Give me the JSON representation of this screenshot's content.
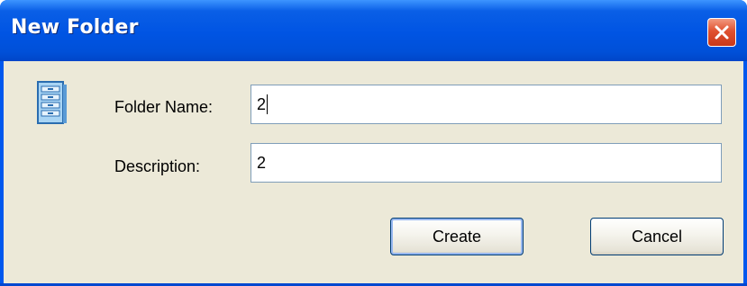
{
  "window": {
    "title": "New Folder"
  },
  "icons": {
    "title_close": "close-icon",
    "dialog": "file-cabinet-icon"
  },
  "form": {
    "folder_name_label": "Folder Name:",
    "folder_name_value": "2",
    "description_label": "Description:",
    "description_value": "2"
  },
  "buttons": {
    "create_label": "Create",
    "cancel_label": "Cancel"
  },
  "colors": {
    "titlebar": "#0054e3",
    "client_background": "#ece9d8",
    "close_button": "#e0512f",
    "input_border": "#7f9db9"
  }
}
